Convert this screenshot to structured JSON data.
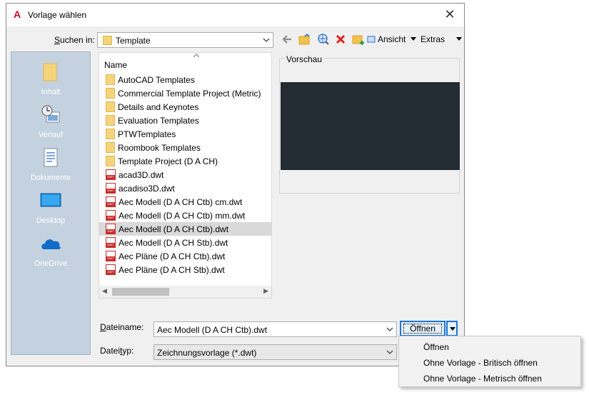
{
  "window": {
    "title": "Vorlage wählen",
    "close_glyph": "✕"
  },
  "lookin": {
    "label": "Suchen in:",
    "value": "Template"
  },
  "toolbar": {
    "ansicht": "Ansicht",
    "extras": "Extras"
  },
  "places": [
    {
      "label": "Inhalt",
      "icon": "folder-icon"
    },
    {
      "label": "Verlauf",
      "icon": "history-icon"
    },
    {
      "label": "Dokumente",
      "icon": "documents-icon"
    },
    {
      "label": "Desktop",
      "icon": "desktop-icon"
    },
    {
      "label": "OneDrive",
      "icon": "cloud-icon"
    }
  ],
  "filelist": {
    "column_header": "Name",
    "items": [
      {
        "name": "AutoCAD Templates",
        "type": "folder"
      },
      {
        "name": "Commercial Template Project (Metric)",
        "type": "folder"
      },
      {
        "name": "Details and Keynotes",
        "type": "folder"
      },
      {
        "name": "Evaluation Templates",
        "type": "folder"
      },
      {
        "name": "PTWTemplates",
        "type": "folder"
      },
      {
        "name": "Roombook Templates",
        "type": "folder"
      },
      {
        "name": "Template Project (D A CH)",
        "type": "folder"
      },
      {
        "name": "acad3D.dwt",
        "type": "dwt"
      },
      {
        "name": "acadiso3D.dwt",
        "type": "dwt"
      },
      {
        "name": "Aec Modell (D A CH Ctb) cm.dwt",
        "type": "dwt"
      },
      {
        "name": "Aec Modell (D A CH Ctb) mm.dwt",
        "type": "dwt"
      },
      {
        "name": "Aec Modell (D A CH Ctb).dwt",
        "type": "dwt",
        "selected": true
      },
      {
        "name": "Aec Modell (D A CH Stb).dwt",
        "type": "dwt"
      },
      {
        "name": "Aec Pläne (D A CH Ctb).dwt",
        "type": "dwt"
      },
      {
        "name": "Aec Pläne (D A CH Stb).dwt",
        "type": "dwt"
      }
    ]
  },
  "preview": {
    "label": "Vorschau"
  },
  "filename": {
    "label": "Dateiname:",
    "value": "Aec Modell (D A CH Ctb).dwt"
  },
  "filetype": {
    "label": "Dateityp:",
    "value": "Zeichnungsvorlage (*.dwt)"
  },
  "open_button": {
    "label": "Öffnen"
  },
  "open_menu": [
    {
      "label": "Öffnen"
    },
    {
      "label": "Ohne Vorlage - Britisch öffnen"
    },
    {
      "label": "Ohne Vorlage - Metrisch öffnen"
    }
  ]
}
